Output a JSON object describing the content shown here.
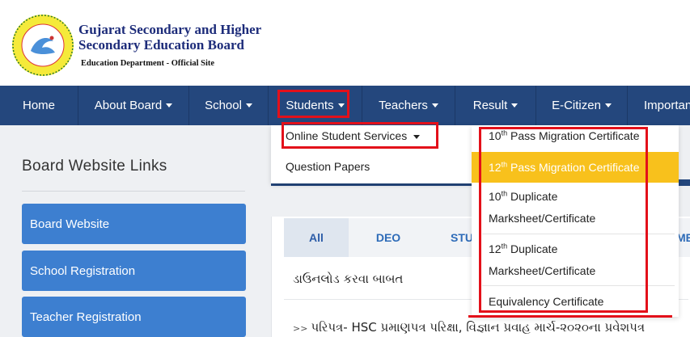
{
  "header": {
    "title_line1": "Gujarat Secondary and Higher",
    "title_line2": "Secondary Education Board",
    "subtitle": "Education Department - Official Site",
    "logo_icon": "gseb-swan-seal-logo"
  },
  "nav": {
    "items": [
      {
        "label": "Home"
      },
      {
        "label": "About Board"
      },
      {
        "label": "School"
      },
      {
        "label": "Students"
      },
      {
        "label": "Teachers"
      },
      {
        "label": "Result"
      },
      {
        "label": "E-Citizen"
      },
      {
        "label": "Important"
      }
    ]
  },
  "students_menu": {
    "items": [
      {
        "label": "Online Student Services"
      },
      {
        "label": "Question Papers"
      }
    ]
  },
  "services_menu": {
    "items": [
      {
        "sup": "th",
        "num": "10",
        "text": "Pass Migration Certificate"
      },
      {
        "sup": "th",
        "num": "12",
        "text": "Pass Migration Certificate"
      },
      {
        "sup": "th",
        "num": "10",
        "text": "Duplicate",
        "line2": "Marksheet/Certificate"
      },
      {
        "sup": "th",
        "num": "12",
        "text": "Duplicate",
        "line2": "Marksheet/Certificate"
      },
      {
        "text": "Equivalency Certificate"
      }
    ]
  },
  "sidebar": {
    "heading": "Board Website Links",
    "links": [
      {
        "label": "Board Website"
      },
      {
        "label": "School Registration"
      },
      {
        "label": "Teacher Registration"
      }
    ]
  },
  "tabs": [
    {
      "label": "All"
    },
    {
      "label": "DEO"
    },
    {
      "label": "STU"
    },
    {
      "label": "MED"
    }
  ],
  "notices": [
    {
      "text": "ડાઉનલોડ કરવા બાબત"
    },
    {
      "prefix": ">>",
      "text": "પરિપત્ર- HSC પ્રમાણપત્ર પરિક્ષા, વિજ્ઞાન પ્રવાહ માર્ચ-૨૦૨૦ના પ્રવેશપત્ર"
    }
  ],
  "colors": {
    "nav_bg": "#24477d",
    "link_button": "#3d7fd0",
    "highlight": "#f8c11c",
    "annotation_red": "#e3101a"
  }
}
